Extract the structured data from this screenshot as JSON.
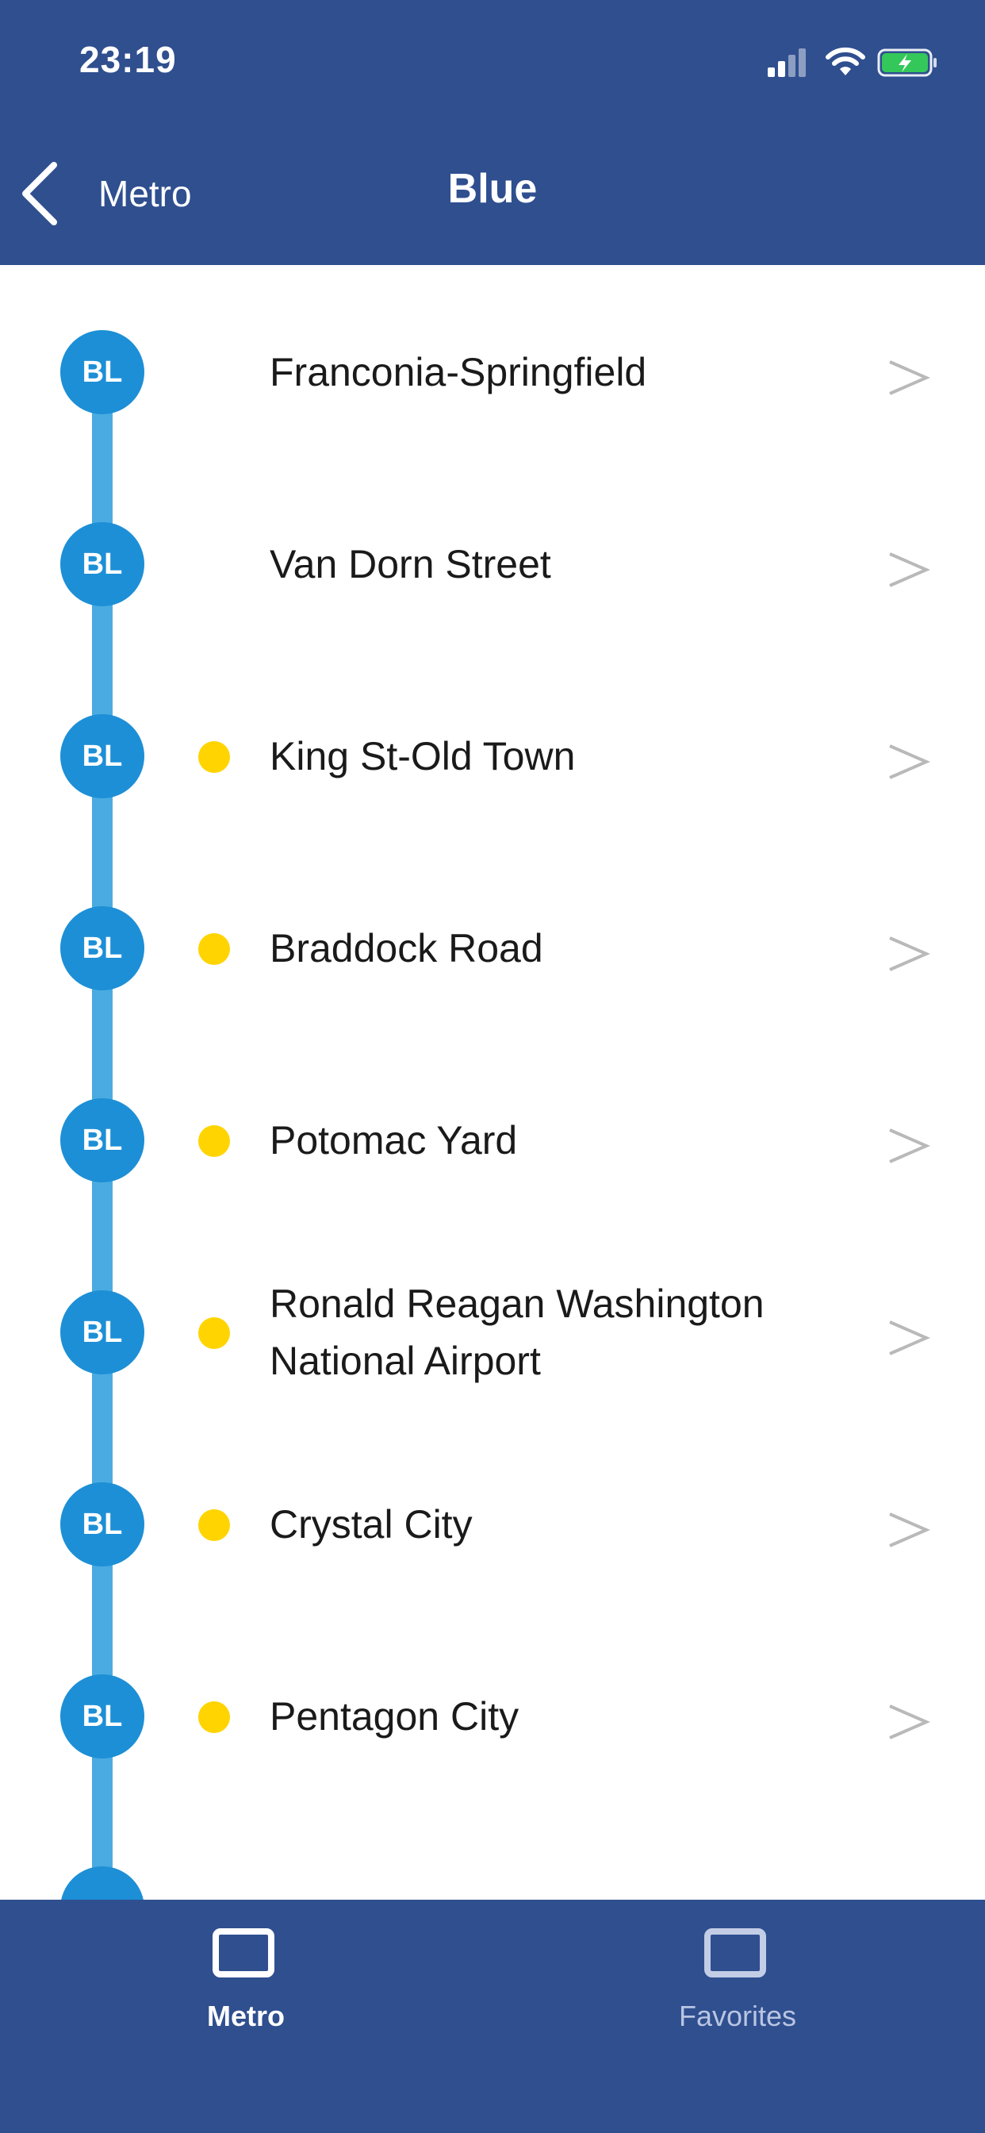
{
  "status_bar": {
    "time": "23:19",
    "icons": [
      "cellular-signal-icon",
      "wifi-icon",
      "battery-charging-icon"
    ],
    "battery_color": "#34c759"
  },
  "nav": {
    "back_label": "Metro",
    "title": "Blue"
  },
  "line": {
    "code": "BL",
    "color": "#1d8fd6",
    "track_color": "#4aabe2"
  },
  "stations": [
    {
      "code": "BL",
      "name": "Franconia-Springfield",
      "has_dot": false
    },
    {
      "code": "BL",
      "name": "Van Dorn Street",
      "has_dot": false
    },
    {
      "code": "BL",
      "name": "King St-Old Town",
      "has_dot": true
    },
    {
      "code": "BL",
      "name": "Braddock Road",
      "has_dot": true
    },
    {
      "code": "BL",
      "name": "Potomac Yard",
      "has_dot": true
    },
    {
      "code": "BL",
      "name": "Ronald Reagan Washington National Airport",
      "has_dot": true
    },
    {
      "code": "BL",
      "name": "Crystal City",
      "has_dot": true
    },
    {
      "code": "BL",
      "name": "Pentagon City",
      "has_dot": true
    }
  ],
  "transfer_dot_color": "#ffd400",
  "chevron": ">",
  "tabbar": {
    "tabs": [
      {
        "label": "Metro",
        "icon": "square-outline-icon",
        "active": true
      },
      {
        "label": "Favorites",
        "icon": "square-outline-icon",
        "active": false
      }
    ]
  },
  "colors": {
    "header_bg": "#2f4f8f",
    "tabbar_bg": "#2f4f8f"
  }
}
